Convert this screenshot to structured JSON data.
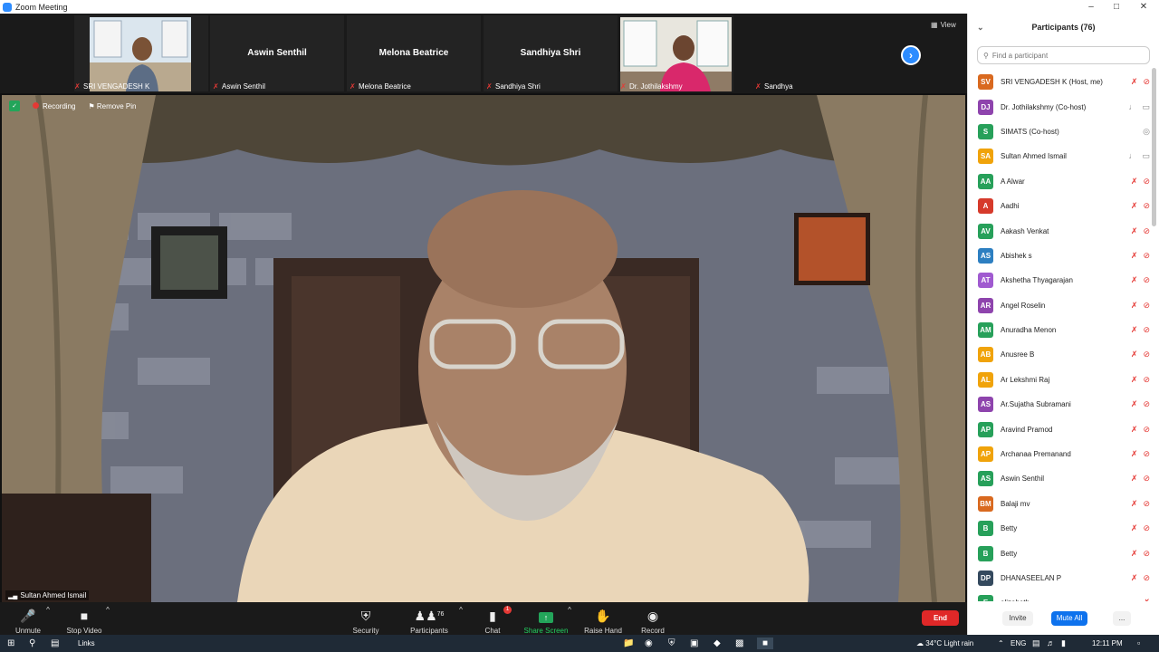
{
  "window": {
    "title": "Zoom Meeting",
    "view_label": "View"
  },
  "strip": {
    "tiles": [
      {
        "name": "SRI VENGADESH K",
        "label": ""
      },
      {
        "name": "Aswin Senthil",
        "label": "Aswin Senthil"
      },
      {
        "name": "Melona Beatrice",
        "label": "Melona Beatrice"
      },
      {
        "name": "Sandhiya Shri",
        "label": "Sandhiya Shri"
      },
      {
        "name": "Dr. Jothilakshmy",
        "label": ""
      },
      {
        "name": "Sandhya",
        "label": ""
      }
    ]
  },
  "main": {
    "recording_label": "Recording",
    "remove_pin_label": "Remove Pin",
    "speaker_name": "Sultan Ahmed Ismail"
  },
  "toolbar": {
    "unmute": "Unmute",
    "stop_video": "Stop Video",
    "security": "Security",
    "participants": "Participants",
    "participants_count": "76",
    "chat": "Chat",
    "chat_badge": "1",
    "share_screen": "Share Screen",
    "raise_hand": "Raise Hand",
    "record": "Record",
    "end": "End"
  },
  "panel": {
    "title": "Participants (76)",
    "search_placeholder": "Find a participant",
    "invite": "Invite",
    "mute_all": "Mute All",
    "more": "...",
    "participants": [
      {
        "initials": "SV",
        "name": "SRI VENGADESH K (Host, me)",
        "color": "#d9691f",
        "mic": "off",
        "cam": "off"
      },
      {
        "initials": "DJ",
        "name": "Dr. Jothilakshmy (Co-host)",
        "color": "#8e44ad",
        "mic": "on",
        "cam": "on"
      },
      {
        "initials": "S",
        "name": "SIMATS (Co-host)",
        "color": "#27a05a",
        "mic": "none",
        "cam": "share"
      },
      {
        "initials": "SA",
        "name": "Sultan Ahmed Ismail",
        "color": "#f0a30a",
        "mic": "on",
        "cam": "on"
      },
      {
        "initials": "AA",
        "name": "A Alwar",
        "color": "#27a05a",
        "mic": "off",
        "cam": "off"
      },
      {
        "initials": "A",
        "name": "Aadhi",
        "color": "#d63a2b",
        "mic": "off",
        "cam": "off"
      },
      {
        "initials": "AV",
        "name": "Aakash Venkat",
        "color": "#27a05a",
        "mic": "off",
        "cam": "off"
      },
      {
        "initials": "AS",
        "name": "Abishek s",
        "color": "#2d7fc1",
        "mic": "off",
        "cam": "off"
      },
      {
        "initials": "AT",
        "name": "Akshetha Thyagarajan",
        "color": "#a05ad0",
        "mic": "off",
        "cam": "off"
      },
      {
        "initials": "AR",
        "name": "Angel Roselin",
        "color": "#8e44ad",
        "mic": "off",
        "cam": "off"
      },
      {
        "initials": "AM",
        "name": "Anuradha Menon",
        "color": "#27a05a",
        "mic": "off",
        "cam": "off"
      },
      {
        "initials": "AB",
        "name": "Anusree B",
        "color": "#f0a30a",
        "mic": "off",
        "cam": "off"
      },
      {
        "initials": "AL",
        "name": "Ar Lekshmi Raj",
        "color": "#f0a30a",
        "mic": "off",
        "cam": "off"
      },
      {
        "initials": "AS",
        "name": "Ar.Sujatha Subramani",
        "color": "#8e44ad",
        "mic": "off",
        "cam": "off"
      },
      {
        "initials": "AP",
        "name": "Aravind Pramod",
        "color": "#27a05a",
        "mic": "off",
        "cam": "off"
      },
      {
        "initials": "AP",
        "name": "Archanaa Premanand",
        "color": "#f0a30a",
        "mic": "off",
        "cam": "off"
      },
      {
        "initials": "AS",
        "name": "Aswin Senthil",
        "color": "#27a05a",
        "mic": "off",
        "cam": "off"
      },
      {
        "initials": "BM",
        "name": "Balaji mv",
        "color": "#d9691f",
        "mic": "off",
        "cam": "off"
      },
      {
        "initials": "B",
        "name": "Betty",
        "color": "#27a05a",
        "mic": "off",
        "cam": "off"
      },
      {
        "initials": "B",
        "name": "Betty",
        "color": "#27a05a",
        "mic": "off",
        "cam": "off"
      },
      {
        "initials": "DP",
        "name": "DHANASEELAN P",
        "color": "#34495e",
        "mic": "off",
        "cam": "off"
      },
      {
        "initials": "E",
        "name": "elizabeth",
        "color": "#27a05a",
        "mic": "off",
        "cam": "none"
      }
    ]
  },
  "taskbar": {
    "links": "Links",
    "weather": "34°C  Light rain",
    "lang": "ENG",
    "time": "12:11 PM"
  }
}
